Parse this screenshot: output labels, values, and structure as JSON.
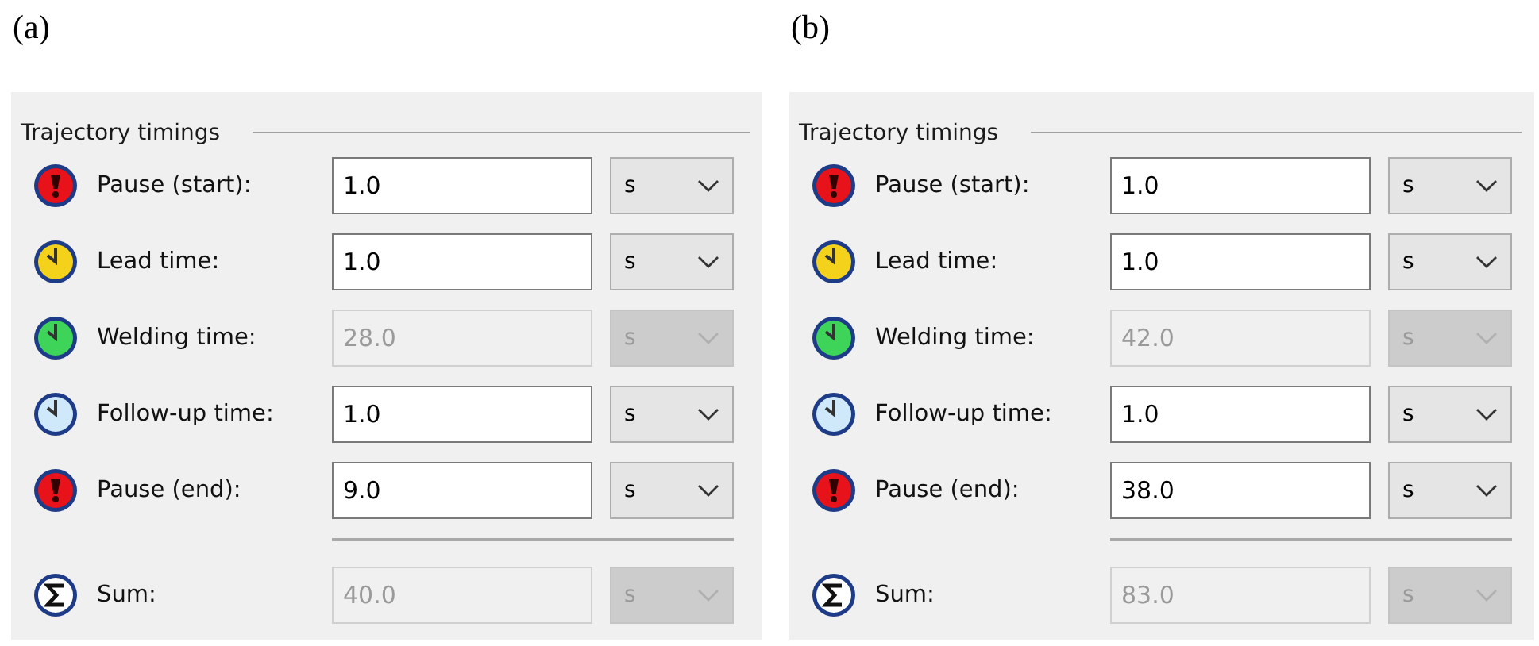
{
  "panels": [
    {
      "caption": "(a)",
      "title": "Trajectory timings",
      "rows": [
        {
          "kind": "alert",
          "color": "#e8121a",
          "label": "Pause (start):",
          "value": "1.0",
          "unit": "s",
          "disabled": false
        },
        {
          "kind": "clock",
          "color": "#f4d21c",
          "label": "Lead time:",
          "value": "1.0",
          "unit": "s",
          "disabled": false
        },
        {
          "kind": "clock",
          "color": "#3ed45a",
          "label": "Welding time:",
          "value": "28.0",
          "unit": "s",
          "disabled": true
        },
        {
          "kind": "clock",
          "color": "#cfe9fb",
          "label": "Follow-up time:",
          "value": "1.0",
          "unit": "s",
          "disabled": false
        },
        {
          "kind": "alert",
          "color": "#e8121a",
          "label": "Pause (end):",
          "value": "9.0",
          "unit": "s",
          "disabled": false
        }
      ],
      "total": {
        "kind": "sum",
        "label": "Sum:",
        "value": "40.0",
        "unit": "s",
        "disabled": true
      }
    },
    {
      "caption": "(b)",
      "title": "Trajectory timings",
      "rows": [
        {
          "kind": "alert",
          "color": "#e8121a",
          "label": "Pause (start):",
          "value": "1.0",
          "unit": "s",
          "disabled": false
        },
        {
          "kind": "clock",
          "color": "#f4d21c",
          "label": "Lead time:",
          "value": "1.0",
          "unit": "s",
          "disabled": false
        },
        {
          "kind": "clock",
          "color": "#3ed45a",
          "label": "Welding time:",
          "value": "42.0",
          "unit": "s",
          "disabled": true
        },
        {
          "kind": "clock",
          "color": "#cfe9fb",
          "label": "Follow-up time:",
          "value": "1.0",
          "unit": "s",
          "disabled": false
        },
        {
          "kind": "alert",
          "color": "#e8121a",
          "label": "Pause (end):",
          "value": "38.0",
          "unit": "s",
          "disabled": false
        }
      ],
      "total": {
        "kind": "sum",
        "label": "Sum:",
        "value": "83.0",
        "unit": "s",
        "disabled": true
      }
    }
  ]
}
